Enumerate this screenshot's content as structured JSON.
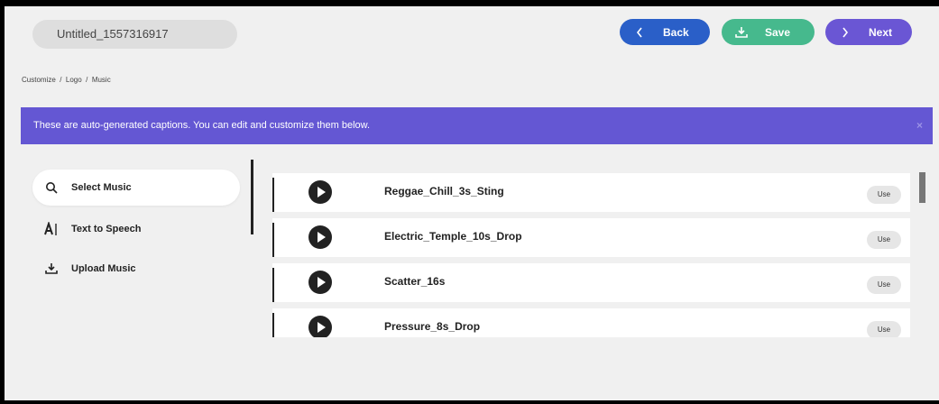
{
  "header": {
    "project_title": "Untitled_1557316917",
    "back_label": "Back",
    "save_label": "Save",
    "next_label": "Next"
  },
  "breadcrumb": "Customize  /  Logo  /  Music",
  "banner": {
    "message": "These are auto-generated captions. You can edit and customize them below.",
    "close": "×"
  },
  "sidebar": {
    "items": [
      {
        "label": "Select Music",
        "icon": "search-icon",
        "active": true
      },
      {
        "label": "Text to Speech",
        "icon": "text-to-speech-icon",
        "active": false
      },
      {
        "label": "Upload Music",
        "icon": "upload-icon",
        "active": false
      }
    ]
  },
  "tracks": {
    "use_label": "Use",
    "items": [
      {
        "name": "Reggae_Chill_3s_Sting"
      },
      {
        "name": "Electric_Temple_10s_Drop"
      },
      {
        "name": "Scatter_16s"
      },
      {
        "name": "Pressure_8s_Drop"
      }
    ]
  },
  "colors": {
    "back": "#2a5fc8",
    "save": "#46b98d",
    "next": "#6a56d4",
    "banner": "#6457d3"
  }
}
